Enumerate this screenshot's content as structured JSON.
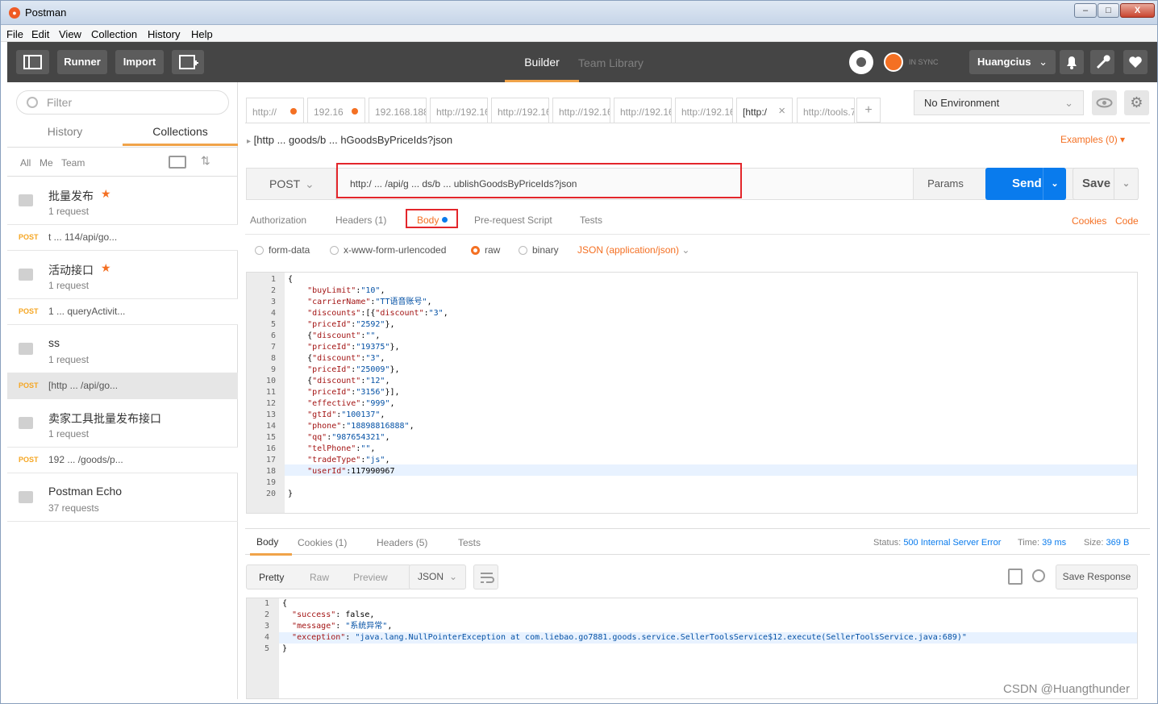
{
  "window": {
    "title": "Postman",
    "min": "–",
    "max": "□",
    "close": "X"
  },
  "menu": [
    "File",
    "Edit",
    "View",
    "Collection",
    "History",
    "Help"
  ],
  "toolbar": {
    "runner": "Runner",
    "import": "Import",
    "builder": "Builder",
    "team_library": "Team Library",
    "sync": "IN SYNC",
    "user": "Huangcius",
    "accent": "#f0a349"
  },
  "sidebar": {
    "filter_placeholder": "Filter",
    "tabs": [
      "History",
      "Collections"
    ],
    "filters": [
      "All",
      "Me",
      "Team"
    ],
    "collections": [
      {
        "name": "批量发布",
        "count": "1 request",
        "starred": true
      },
      {
        "name": "活动接口",
        "count": "1 request",
        "starred": true
      },
      {
        "name": "ss",
        "count": "1 request",
        "starred": false
      },
      {
        "name": "卖家工具批量发布接口",
        "count": "1 request",
        "starred": false
      },
      {
        "name": "Postman Echo",
        "count": "37 requests",
        "starred": false
      }
    ],
    "requests": [
      {
        "method": "POST",
        "text": "t ... 114/api/go..."
      },
      {
        "method": "POST",
        "text": "1 ... queryActivit..."
      },
      {
        "method": "POST",
        "text": "[http ... /api/go..."
      },
      {
        "method": "POST",
        "text": "192 ... /goods/p..."
      }
    ]
  },
  "tabs": [
    {
      "label": "http://",
      "dot": true
    },
    {
      "label": "192.16",
      "dot": true
    },
    {
      "label": "192.168.188",
      "dot": false
    },
    {
      "label": "http://192.16",
      "dot": false
    },
    {
      "label": "http://192.16",
      "dot": false
    },
    {
      "label": "http://192.16",
      "dot": false
    },
    {
      "label": "http://192.16",
      "dot": false
    },
    {
      "label": "http://192.16",
      "dot": false
    },
    {
      "label": "[http:/",
      "dot": false,
      "active": true,
      "close": "×"
    },
    {
      "label": "http://tools.7",
      "dot": false
    }
  ],
  "tab_add": "+",
  "environment": "No Environment",
  "request": {
    "breadcrumb": "[http ... goods/b ... hGoodsByPriceIds?json",
    "examples": "Examples (0)",
    "method": "POST",
    "url": "http:/ ... /api/g ... ds/b ... ublishGoodsByPriceIds?json",
    "params": "Params",
    "send": "Send",
    "save": "Save",
    "tabs": {
      "authorization": "Authorization",
      "headers": "Headers (1)",
      "body": "Body",
      "prerequest": "Pre-request Script",
      "tests": "Tests"
    },
    "cookies": "Cookies",
    "code": "Code",
    "body_types": [
      "form-data",
      "x-www-form-urlencoded",
      "raw",
      "binary"
    ],
    "content_type": "JSON (application/json)"
  },
  "request_body_lines": [
    "{",
    "    \"buyLimit\":\"10\",",
    "    \"carrierName\":\"TT语音账号\",",
    "    \"discounts\":[{\"discount\":\"3\",",
    "    \"priceId\":\"2592\"},",
    "    {\"discount\":\"\",",
    "    \"priceId\":\"19375\"},",
    "    {\"discount\":\"3\",",
    "    \"priceId\":\"25009\"},",
    "    {\"discount\":\"12\",",
    "    \"priceId\":\"3156\"}],",
    "    \"effective\":\"999\",",
    "    \"gtId\":\"100137\",",
    "    \"phone\":\"18898816888\",",
    "    \"qq\":\"987654321\",",
    "    \"telPhone\":\"\",",
    "    \"tradeType\":\"js\",",
    "    \"userId\":117990967",
    "",
    "}"
  ],
  "response": {
    "tabs": {
      "body": "Body",
      "cookies": "Cookies (1)",
      "headers": "Headers (5)",
      "tests": "Tests"
    },
    "status_label": "Status:",
    "status": "500 Internal Server Error",
    "time_label": "Time:",
    "time": "39 ms",
    "size_label": "Size:",
    "size": "369 B",
    "formats": [
      "Pretty",
      "Raw",
      "Preview"
    ],
    "lang": "JSON",
    "save_response": "Save Response",
    "lines": [
      "{",
      "  \"success\": false,",
      "  \"message\": \"系统异常\",",
      "  \"exception\": \"java.lang.NullPointerException at com.liebao.go7881.goods.service.SellerToolsService$12.execute(SellerToolsService.java:689)\"",
      "}"
    ]
  },
  "watermark": "CSDN @Huangthunder"
}
